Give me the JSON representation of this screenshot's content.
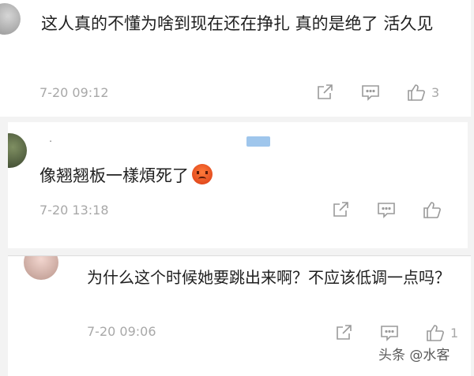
{
  "comments": [
    {
      "text": "这人真的不懂为啥到现在还在挣扎 真的是绝了 活久见",
      "time": "7-20 09:12",
      "like_count": "3"
    },
    {
      "username": ".",
      "text": "像翘翘板一樣煩死了",
      "time": "7-20 13:18",
      "like_count": ""
    },
    {
      "text": "为什么这个时候她要跳出来啊？不应该低调一点吗？",
      "time": "7-20 09:06",
      "like_count": "1"
    }
  ],
  "icons": {
    "share": "share-icon",
    "reply": "comment-icon",
    "like": "thumbs-up-icon",
    "emoji": "angry-face-emoji"
  },
  "watermark": "头条 @水客"
}
